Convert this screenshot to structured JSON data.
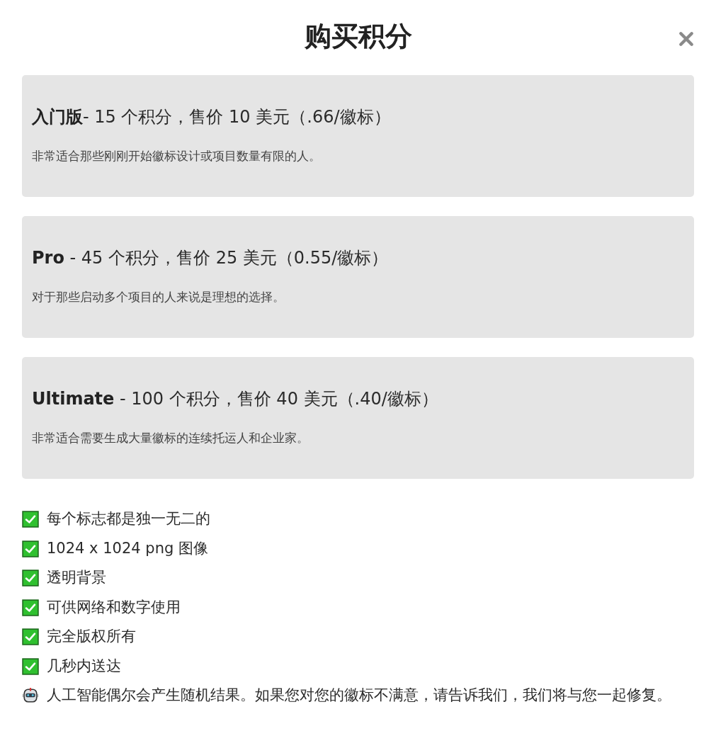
{
  "title": "购买积分",
  "plans": [
    {
      "heading": "**入门版**- 15 个积分，售价 10 美元（.66/徽标）",
      "description": "非常适合那些刚刚开始徽标设计或项目数量有限的人。"
    },
    {
      "heading": "**Pro** - 45 个积分，售价 25 美元（0.55/徽标）",
      "description": "对于那些启动多个项目的人来说是理想的选择。"
    },
    {
      "heading": "**Ultimate** - 100 个积分，售价 40 美元（.40/徽标）",
      "description": "非常适合需要生成大量徽标的连续托运人和企业家。"
    }
  ],
  "features": [
    {
      "kind": "check",
      "text": "每个标志都是独一无二的"
    },
    {
      "kind": "check",
      "text": "1024 x 1024 png 图像"
    },
    {
      "kind": "check",
      "text": "透明背景"
    },
    {
      "kind": "check",
      "text": "可供网络和数字使用"
    },
    {
      "kind": "check",
      "text": "完全版权所有"
    },
    {
      "kind": "check",
      "text": "几秒内送达"
    },
    {
      "kind": "note",
      "text": "人工智能偶尔会产生随机结果。如果您对您的徽标不满意，请告诉我们，我们将与您一起修复。"
    }
  ]
}
